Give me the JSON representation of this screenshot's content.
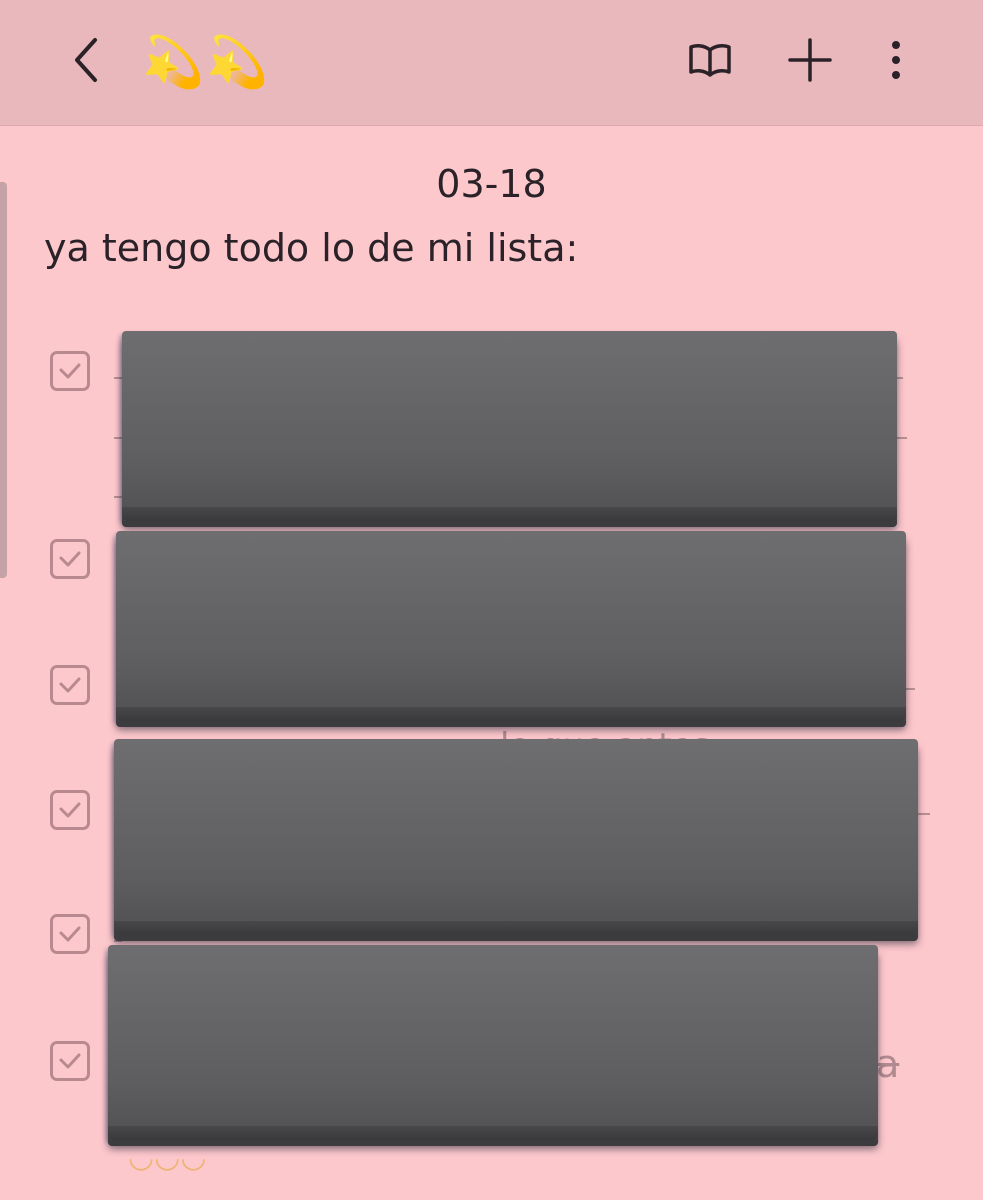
{
  "app": {
    "title_emoji": "💫💫",
    "icons": {
      "back": "chevron-left-icon",
      "reading_mode": "open-book-icon",
      "add": "plus-icon",
      "more": "vertical-dots-icon"
    },
    "colors": {
      "toolbar": "#e8b8bc",
      "background": "#fdc8cc",
      "checkbox": "#b88a90",
      "redaction": "#5e5e60"
    }
  },
  "note": {
    "date": "03-18",
    "intro": "ya tengo todo lo de mi lista:",
    "checklist": [
      {
        "checked": true
      },
      {
        "checked": true
      },
      {
        "checked": true
      },
      {
        "checked": true
      },
      {
        "checked": true
      },
      {
        "checked": true
      }
    ],
    "partial_fragments": {
      "item4_trailing": "lo que antes",
      "item6_trailing": "a"
    }
  }
}
